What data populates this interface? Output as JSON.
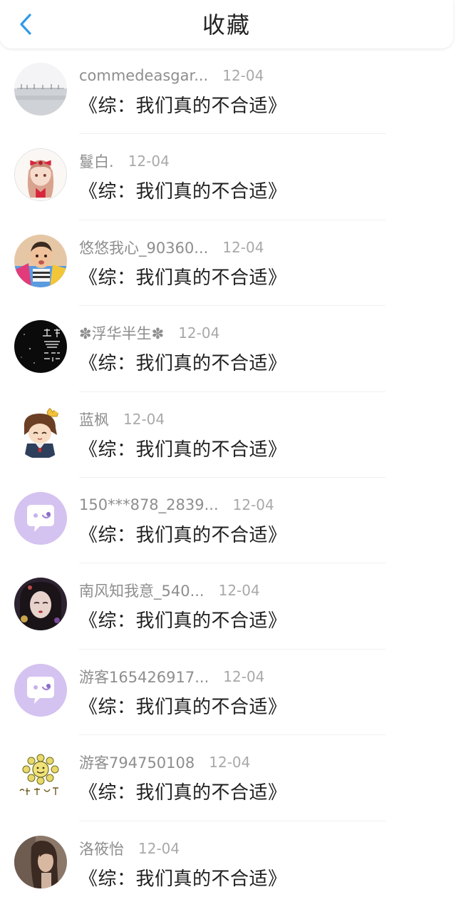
{
  "header": {
    "title": "收藏",
    "back_icon": "chevron-left-icon",
    "accent_color": "#2f9bea"
  },
  "list": {
    "items": [
      {
        "name": "commedeasgar...",
        "date": "12-04",
        "book": "《综：我们真的不合适》",
        "avatar": "photo-snow-landscape"
      },
      {
        "name": "鬘白.",
        "date": "12-04",
        "book": "《综：我们真的不合适》",
        "avatar": "anime-girl-red-bow"
      },
      {
        "name": "悠悠我心_90360...",
        "date": "12-04",
        "book": "《综：我们真的不合适》",
        "avatar": "photo-toddler"
      },
      {
        "name": "✽浮华半生✽",
        "date": "12-04",
        "book": "《综：我们真的不合适》",
        "avatar": "dark-calligraphy"
      },
      {
        "name": "蓝枫",
        "date": "12-04",
        "book": "《综：我们真的不合适》",
        "avatar": "chibi-character-crown"
      },
      {
        "name": "150***878_2839...",
        "date": "12-04",
        "book": "《综：我们真的不合适》",
        "avatar": "default-purple-chat"
      },
      {
        "name": "南风知我意_540...",
        "date": "12-04",
        "book": "《综：我们真的不合适》",
        "avatar": "dark-portrait"
      },
      {
        "name": "游客165426917...",
        "date": "12-04",
        "book": "《综：我们真的不合适》",
        "avatar": "default-purple-chat"
      },
      {
        "name": "游客794750108",
        "date": "12-04",
        "book": "《综：我们真的不合适》",
        "avatar": "sun-god-emblem"
      },
      {
        "name": "洛筱怡",
        "date": "12-04",
        "book": "《综：我们真的不合适》",
        "avatar": "photo-portrait"
      }
    ]
  }
}
